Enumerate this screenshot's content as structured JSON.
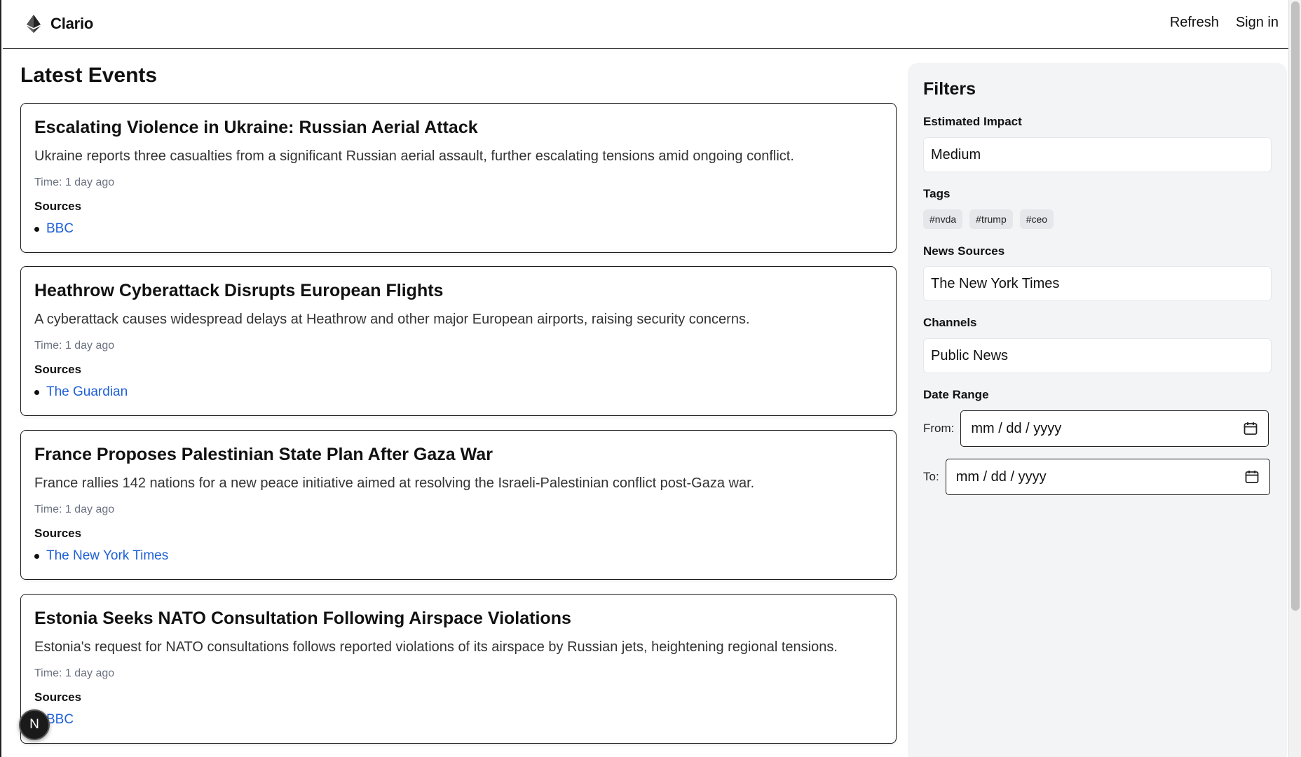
{
  "header": {
    "brand": "Clario",
    "nav": {
      "refresh": "Refresh",
      "sign_in": "Sign in"
    }
  },
  "main": {
    "title": "Latest Events",
    "events": [
      {
        "title": "Escalating Violence in Ukraine: Russian Aerial Attack",
        "summary": "Ukraine reports three casualties from a significant Russian aerial assault, further escalating tensions amid ongoing conflict.",
        "time": "Time: 1 day ago",
        "sources_label": "Sources",
        "sources": [
          "BBC"
        ]
      },
      {
        "title": "Heathrow Cyberattack Disrupts European Flights",
        "summary": "A cyberattack causes widespread delays at Heathrow and other major European airports, raising security concerns.",
        "time": "Time: 1 day ago",
        "sources_label": "Sources",
        "sources": [
          "The Guardian"
        ]
      },
      {
        "title": "France Proposes Palestinian State Plan After Gaza War",
        "summary": "France rallies 142 nations for a new peace initiative aimed at resolving the Israeli-Palestinian conflict post-Gaza war.",
        "time": "Time: 1 day ago",
        "sources_label": "Sources",
        "sources": [
          "The New York Times"
        ]
      },
      {
        "title": "Estonia Seeks NATO Consultation Following Airspace Violations",
        "summary": "Estonia's request for NATO consultations follows reported violations of its airspace by Russian jets, heightening regional tensions.",
        "time": "Time: 1 day ago",
        "sources_label": "Sources",
        "sources": [
          "BBC"
        ]
      }
    ]
  },
  "filters": {
    "title": "Filters",
    "impact": {
      "label": "Estimated Impact",
      "value": "Medium"
    },
    "tags": {
      "label": "Tags",
      "items": [
        "#nvda",
        "#trump",
        "#ceo"
      ]
    },
    "news_sources": {
      "label": "News Sources",
      "value": "The New York Times"
    },
    "channels": {
      "label": "Channels",
      "value": "Public News"
    },
    "date_range": {
      "label": "Date Range",
      "from_label": "From:",
      "to_label": "To:",
      "placeholder": "mm / dd / yyyy"
    }
  },
  "badge": {
    "letter": "N"
  },
  "icons": {
    "brand": "ethereum-diamond-icon",
    "calendar": "calendar-icon"
  }
}
